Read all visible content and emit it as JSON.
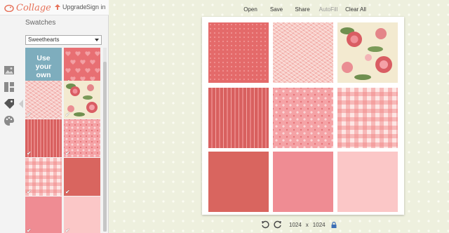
{
  "app": {
    "name": "Collage",
    "upgrade_label": "Upgrade",
    "signin_label": "Sign in"
  },
  "sidebar": {
    "title": "Swatches",
    "select_value": "Sweethearts",
    "use_own_label": "Use your own",
    "rail_icons": [
      "image-icon",
      "layout-icon",
      "swatch-tag-icon",
      "palette-icon"
    ]
  },
  "toolbar": {
    "open": "Open",
    "save": "Save",
    "share": "Share",
    "autofill": "AutoFill",
    "clear_all": "Clear All"
  },
  "size": {
    "width": "1024",
    "separator": "x",
    "height": "1024"
  },
  "colors": {
    "accent": "#e6725a",
    "use_own": "#7eadbd",
    "coral": "#d9625c",
    "pink": "#f0878f",
    "light_pink": "#fbc8c8"
  }
}
